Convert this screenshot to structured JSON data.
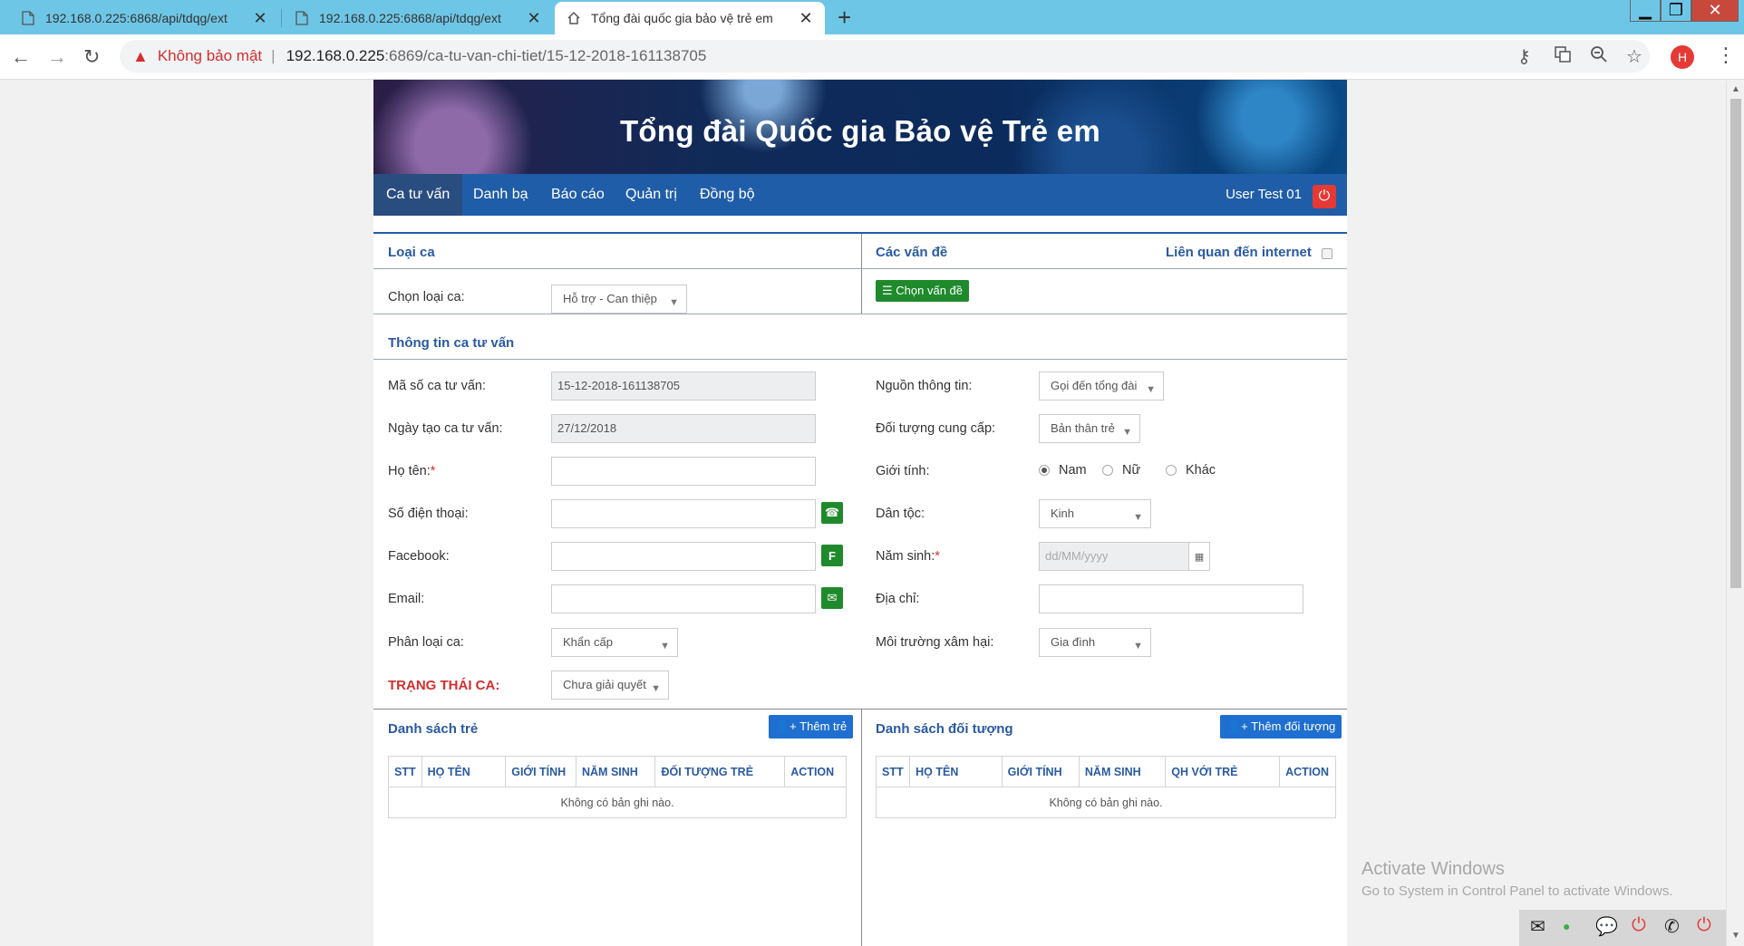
{
  "browser": {
    "tabs": [
      {
        "title": "192.168.0.225:6868/api/tdqg/ext",
        "icon": "document-icon"
      },
      {
        "title": "192.168.0.225:6868/api/tdqg/ext",
        "icon": "document-icon"
      },
      {
        "title": "Tổng đài quốc gia bảo vệ trẻ em",
        "icon": "home-icon",
        "active": true
      }
    ],
    "insecure_label": "Không bảo mật",
    "url_host": "192.168.0.225",
    "url_path": ":6869/ca-tu-van-chi-tiet/15-12-2018-161138705",
    "profile_initial": "H"
  },
  "banner": {
    "title": "Tổng đài Quốc gia Bảo vệ Trẻ em"
  },
  "menu": {
    "items": [
      "Ca tư vấn",
      "Danh bạ",
      "Báo cáo",
      "Quản trị",
      "Đồng bộ"
    ],
    "user": "User Test 01"
  },
  "loai_ca": {
    "title": "Loại ca",
    "label": "Chọn loại ca:",
    "value": "Hỗ trợ - Can thiệp"
  },
  "van_de": {
    "title": "Các vấn đề",
    "internet_label": "Liên quan đến internet",
    "button": "Chọn vấn đề"
  },
  "thong_tin": {
    "title": "Thông tin ca tư vấn",
    "ma_so_label": "Mã số ca tư vấn:",
    "ma_so_value": "15-12-2018-161138705",
    "ngay_tao_label": "Ngày tạo ca tư vấn:",
    "ngay_tao_value": "27/12/2018",
    "ho_ten_label": "Họ tên:",
    "required_mark": "*",
    "sdt_label": "Số điện thoại:",
    "facebook_label": "Facebook:",
    "facebook_btn": "F",
    "email_label": "Email:",
    "phan_loai_label": "Phân loại ca:",
    "phan_loai_value": "Khẩn cấp",
    "trang_thai_label": "TRẠNG THÁI CA:",
    "trang_thai_value": "Chưa giải quyết",
    "nguon_label": "Nguồn thông tin:",
    "nguon_value": "Gọi đến tổng đài",
    "doi_tuong_label": "Đối tượng cung cấp:",
    "doi_tuong_value": "Bản thân trẻ",
    "gioi_tinh_label": "Giới tính:",
    "gioi_tinh_options": [
      "Nam",
      "Nữ",
      "Khác"
    ],
    "gioi_tinh_selected": "Nam",
    "dan_toc_label": "Dân tộc:",
    "dan_toc_value": "Kinh",
    "nam_sinh_label": "Năm sinh:",
    "nam_sinh_placeholder": "dd/MM/yyyy",
    "dia_chi_label": "Địa chỉ:",
    "moi_truong_label": "Môi trường xâm hại:",
    "moi_truong_value": "Gia đình"
  },
  "danh_sach_tre": {
    "title": "Danh sách trẻ",
    "button": "Thêm trẻ",
    "columns": [
      "STT",
      "HỌ TÊN",
      "GIỚI TÍNH",
      "NĂM SINH",
      "ĐỐI TƯỢNG TRẺ",
      "ACTION"
    ],
    "empty": "Không có bản ghi nào."
  },
  "danh_sach_doi_tuong": {
    "title": "Danh sách đối tượng",
    "button": "Thêm đối tượng",
    "columns": [
      "STT",
      "HỌ TÊN",
      "GIỚI TÍNH",
      "NĂM SINH",
      "QH VỚI TRẺ",
      "ACTION"
    ],
    "empty": "Không có bản ghi nào."
  },
  "watermark": {
    "line1": "Activate Windows",
    "line2": "Go to System in Control Panel to activate Windows."
  }
}
